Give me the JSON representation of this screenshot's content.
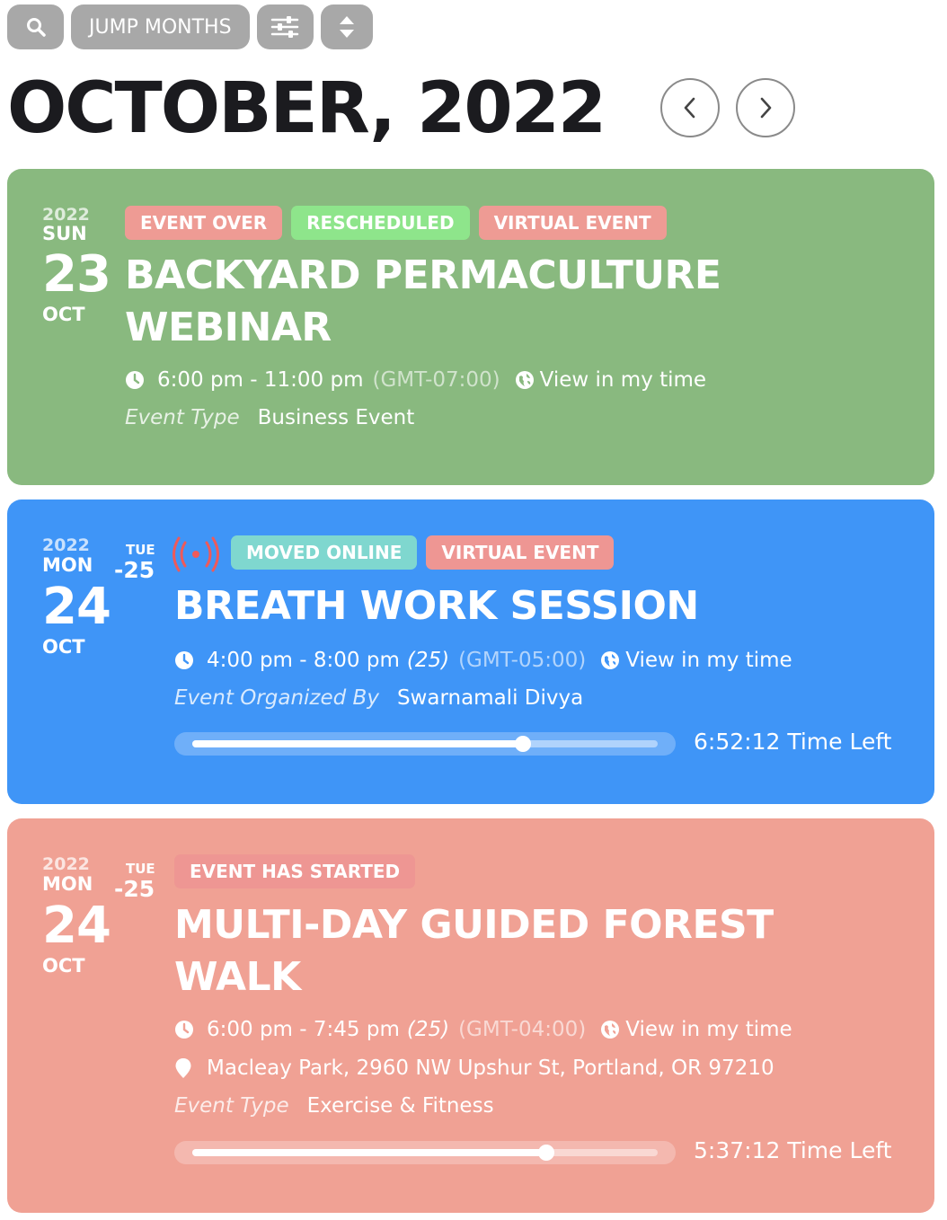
{
  "toolbar": {
    "search_icon": "search-icon",
    "jump_months_label": "JUMP MONTHS",
    "filter_icon": "sliders-icon",
    "sort_icon": "sort-icon"
  },
  "header": {
    "month_title": "OCTOBER, 2022",
    "prev_icon": "chevron-left-icon",
    "next_icon": "chevron-right-icon"
  },
  "events": [
    {
      "year": "2022",
      "weekday": "SUN",
      "day": "23",
      "month": "OCT",
      "tags": [
        "EVENT OVER",
        "RESCHEDULED",
        "VIRTUAL EVENT"
      ],
      "title": "BACKYARD PERMACULTURE WEBINAR",
      "time": "6:00 pm - 11:00 pm",
      "timezone": "(GMT-07:00)",
      "view_time_label": "View in my time",
      "meta_label": "Event Type",
      "meta_value": "Business Event",
      "color": "#89b97f"
    },
    {
      "year": "2022",
      "weekday": "MON",
      "day": "24",
      "month": "OCT",
      "end_weekday": "TUE",
      "end_day": "-25",
      "live_icon": "live-broadcast-icon",
      "tags": [
        "MOVED ONLINE",
        "VIRTUAL EVENT"
      ],
      "title": "BREATH WORK SESSION",
      "time": "4:00 pm - 8:00 pm",
      "time_suffix": "(25)",
      "timezone": "(GMT-05:00)",
      "view_time_label": "View in my time",
      "meta_label": "Event Organized By",
      "meta_value": "Swarnamali Divya",
      "progress": 0.71,
      "time_left": "6:52:12 Time Left",
      "color": "#3f95f7"
    },
    {
      "year": "2022",
      "weekday": "MON",
      "day": "24",
      "month": "OCT",
      "end_weekday": "TUE",
      "end_day": "-25",
      "tags": [
        "EVENT HAS STARTED"
      ],
      "title": "MULTI-DAY GUIDED FOREST WALK",
      "time": "6:00 pm - 7:45 pm",
      "time_suffix": "(25)",
      "timezone": "(GMT-04:00)",
      "view_time_label": "View in my time",
      "location": "Macleay Park, 2960 NW Upshur St, Portland, OR 97210",
      "meta_label": "Event Type",
      "meta_value": "Exercise & Fitness",
      "progress": 0.76,
      "time_left": "5:37:12 Time Left",
      "color": "#f0a194"
    }
  ]
}
